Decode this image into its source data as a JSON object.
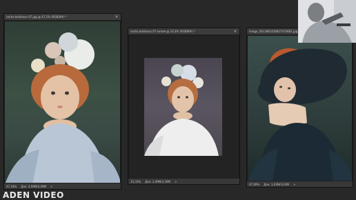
{
  "documents": [
    {
      "title": "sasha bolshova 07.jpg @ 47,1% (RGB/8#) *",
      "zoom": "47,18%",
      "doc_info": "Док: 4,09M/4,09M"
    },
    {
      "title": "sasha bolshova 07 копия @ 33,3% (RGB/8#) *",
      "zoom": "33,33%",
      "doc_info": "Док: 2,09M/3,39M"
    },
    {
      "title": "image_5612891456827474681.jpg @ 47,1% (RGB/8#) *",
      "zoom": "47,09%",
      "doc_info": "Док: 3,03M/3,03M"
    }
  ],
  "close_glyph": "×",
  "arrow_glyph": ">",
  "watermark": "ADEN VIDEO"
}
